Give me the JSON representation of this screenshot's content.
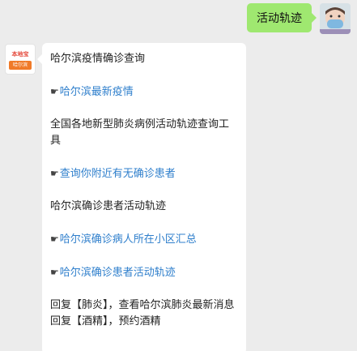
{
  "user": {
    "message": "活动轨迹"
  },
  "bot": {
    "logo_top": "本地宝",
    "logo_city": "哈尔滨",
    "lines": [
      {
        "type": "text",
        "text": "哈尔滨疫情确诊查询"
      },
      {
        "type": "link",
        "icon": "☛",
        "text": "哈尔滨最新疫情"
      },
      {
        "type": "text",
        "text": "全国各地新型肺炎病例活动轨迹查询工具"
      },
      {
        "type": "link",
        "icon": "☛",
        "text": "查询你附近有无确诊患者"
      },
      {
        "type": "text",
        "text": "哈尔滨确诊患者活动轨迹"
      },
      {
        "type": "link",
        "icon": "☛",
        "text": "哈尔滨确诊病人所在小区汇总"
      },
      {
        "type": "link",
        "icon": "☛",
        "text": "哈尔滨确诊患者活动轨迹"
      },
      {
        "type": "text",
        "text": "回复【肺炎】，查看哈尔滨肺炎最新消息"
      },
      {
        "type": "text",
        "text": "回复【酒精】，预约酒精"
      }
    ]
  },
  "colors": {
    "user_bubble": "#9fe870",
    "link": "#2f7fcc",
    "background": "#ececec"
  }
}
